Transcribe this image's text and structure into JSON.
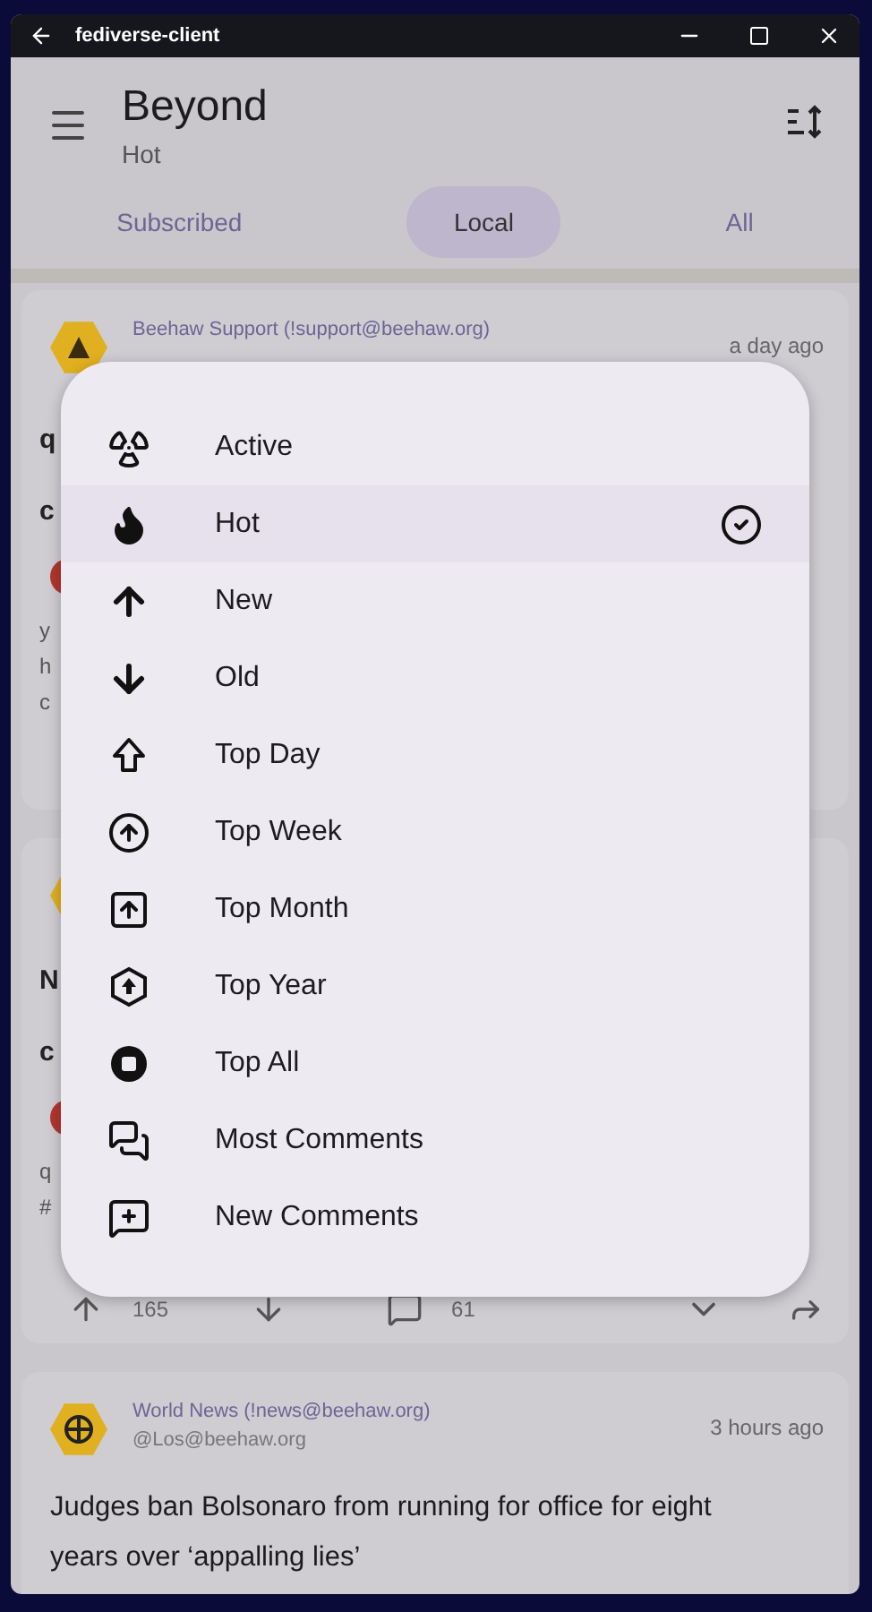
{
  "window": {
    "title": "fediverse-client"
  },
  "app_bar": {
    "title": "Beyond",
    "subtitle": "Hot"
  },
  "tabs": [
    {
      "label": "Subscribed",
      "selected": false
    },
    {
      "label": "Local",
      "selected": true
    },
    {
      "label": "All",
      "selected": false
    }
  ],
  "posts": [
    {
      "community": "Beehaw Support (!support@beehaw.org)",
      "time": "a day ago",
      "title_lines": [
        "q",
        "c"
      ],
      "body_lines": [
        "y",
        "h",
        "c"
      ]
    },
    {
      "title_lines": [
        "N",
        "c"
      ],
      "body_lines": [
        "q",
        "#"
      ],
      "upvotes": "165",
      "comments": "61"
    },
    {
      "community": "World News (!news@beehaw.org)",
      "author": "@Los@beehaw.org",
      "time": "3 hours ago",
      "title_lines": [
        "Judges ban Bolsonaro from running for office for eight",
        "years over ‘appalling lies’"
      ]
    }
  ],
  "sort_menu": [
    {
      "kind": "active",
      "label": "Active",
      "selected": false
    },
    {
      "kind": "hot",
      "label": "Hot",
      "selected": true
    },
    {
      "kind": "new",
      "label": "New",
      "selected": false
    },
    {
      "kind": "old",
      "label": "Old",
      "selected": false
    },
    {
      "kind": "top_day",
      "label": "Top Day",
      "selected": false
    },
    {
      "kind": "top_week",
      "label": "Top Week",
      "selected": false
    },
    {
      "kind": "top_month",
      "label": "Top Month",
      "selected": false
    },
    {
      "kind": "top_year",
      "label": "Top Year",
      "selected": false
    },
    {
      "kind": "top_all",
      "label": "Top All",
      "selected": false
    },
    {
      "kind": "most_comments",
      "label": "Most Comments",
      "selected": false
    },
    {
      "kind": "new_comments",
      "label": "New Comments",
      "selected": false
    }
  ]
}
